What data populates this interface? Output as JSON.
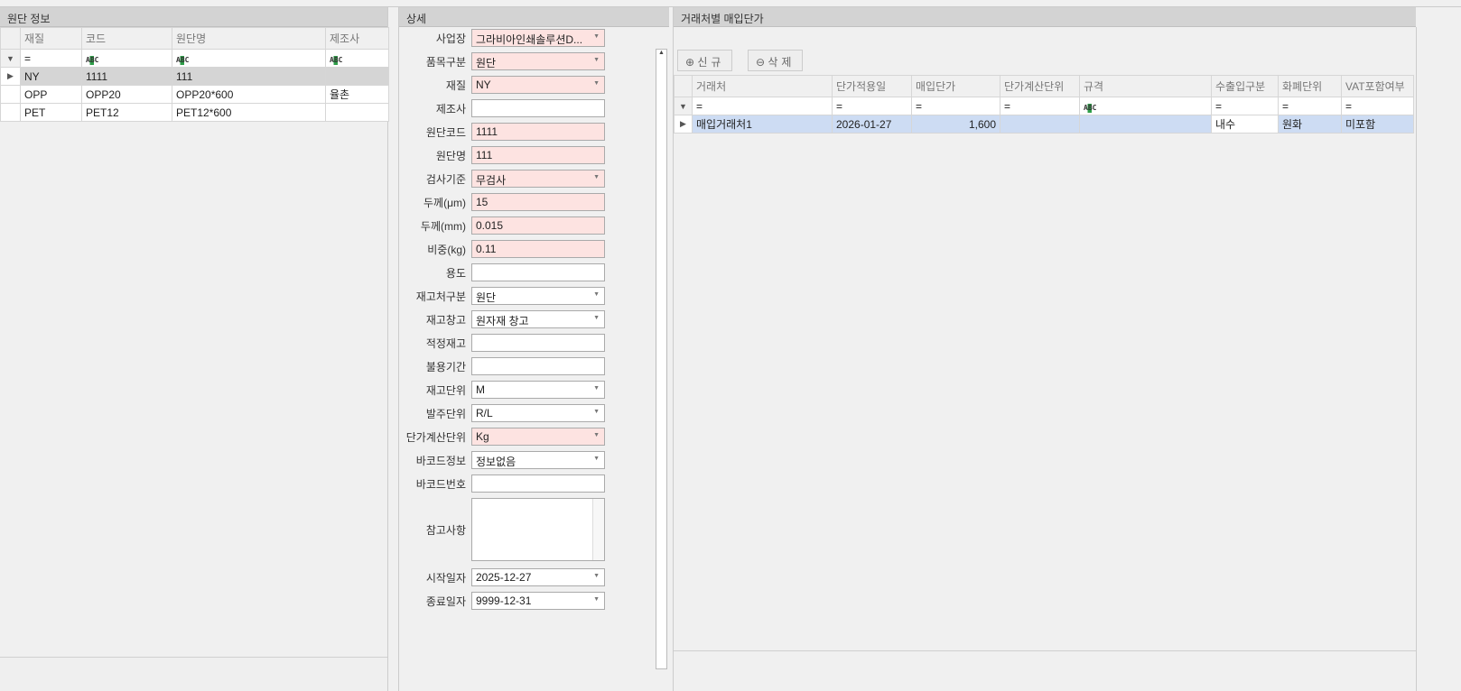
{
  "left": {
    "title": "원단 정보",
    "columns": [
      "재질",
      "코드",
      "원단명",
      "제조사"
    ],
    "filter": [
      "=",
      "ABC",
      "ABC",
      "ABC"
    ],
    "rows": [
      [
        "NY",
        "1111",
        "111",
        ""
      ],
      [
        "OPP",
        "OPP20",
        "OPP20*600",
        "율촌"
      ],
      [
        "PET",
        "PET12",
        "PET12*600",
        ""
      ]
    ]
  },
  "detail": {
    "title": "상세",
    "fields": [
      {
        "label": "사업장",
        "value": "그라비아인쇄솔루션D...",
        "req": true,
        "dd": true
      },
      {
        "label": "품목구분",
        "value": "원단",
        "req": true,
        "dd": true
      },
      {
        "label": "재질",
        "value": "NY",
        "req": true,
        "dd": true
      },
      {
        "label": "제조사",
        "value": "",
        "req": false,
        "dd": false
      },
      {
        "label": "원단코드",
        "value": "1111",
        "req": true,
        "dd": false
      },
      {
        "label": "원단명",
        "value": "111",
        "req": true,
        "dd": false
      },
      {
        "label": "검사기준",
        "value": "무검사",
        "req": true,
        "dd": true
      },
      {
        "label": "두께(μm)",
        "value": "15",
        "req": true,
        "dd": false
      },
      {
        "label": "두께(mm)",
        "value": "0.015",
        "req": true,
        "dd": false
      },
      {
        "label": "비중(kg)",
        "value": "0.11",
        "req": true,
        "dd": false
      },
      {
        "label": "용도",
        "value": "",
        "req": false,
        "dd": false
      },
      {
        "label": "재고처구분",
        "value": "원단",
        "req": false,
        "dd": true
      },
      {
        "label": "재고창고",
        "value": "원자재 창고",
        "req": false,
        "dd": true
      },
      {
        "label": "적정재고",
        "value": "",
        "req": false,
        "dd": false
      },
      {
        "label": "불용기간",
        "value": "",
        "req": false,
        "dd": false
      },
      {
        "label": "재고단위",
        "value": "M",
        "req": false,
        "dd": true
      },
      {
        "label": "발주단위",
        "value": "R/L",
        "req": false,
        "dd": true
      },
      {
        "label": "단가계산단위",
        "value": "Kg",
        "req": true,
        "dd": true
      },
      {
        "label": "바코드정보",
        "value": "정보없음",
        "req": false,
        "dd": true
      },
      {
        "label": "바코드번호",
        "value": "",
        "req": false,
        "dd": false
      }
    ],
    "memo_label": "참고사항",
    "memo": "",
    "dates": [
      {
        "label": "시작일자",
        "value": "2025-12-27"
      },
      {
        "label": "종료일자",
        "value": "9999-12-31"
      }
    ]
  },
  "right": {
    "title": "거래처별 매입단가",
    "new_label": "신규",
    "delete_label": "삭제",
    "columns": [
      "거래처",
      "단가적용일",
      "매입단가",
      "단가계산단위",
      "규격",
      "수출입구분",
      "화폐단위",
      "VAT포함여부"
    ],
    "filter": [
      "=",
      "=",
      "=",
      "=",
      "ABC",
      "=",
      "=",
      "="
    ],
    "rows": [
      [
        "매입거래처1",
        "2026-01-27",
        "1,600",
        "",
        "",
        "내수",
        "원화",
        "미포함"
      ]
    ]
  }
}
